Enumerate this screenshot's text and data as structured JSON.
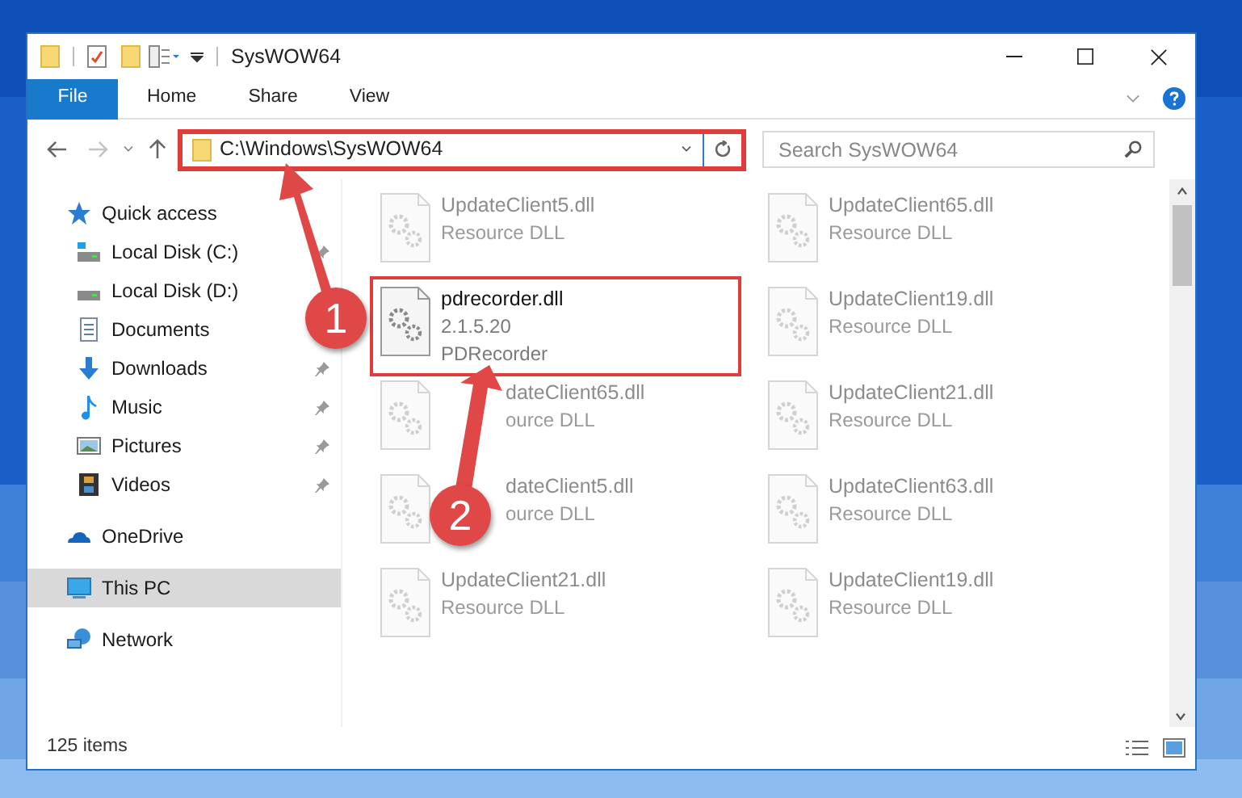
{
  "window": {
    "title": "SysWOW64"
  },
  "ribbon": {
    "tabs": [
      {
        "label": "File",
        "selected": true
      },
      {
        "label": "Home",
        "selected": false
      },
      {
        "label": "Share",
        "selected": false
      },
      {
        "label": "View",
        "selected": false
      }
    ]
  },
  "address": {
    "path": "C:\\Windows\\SysWOW64",
    "annotated": true
  },
  "search": {
    "placeholder": "Search SysWOW64"
  },
  "sidebar": {
    "items": [
      {
        "label": "Quick access",
        "kind": "quick",
        "selected": false,
        "pinned": false,
        "children": [
          {
            "label": "Local Disk (C:)",
            "kind": "diskc",
            "selected": false,
            "pinned": true
          },
          {
            "label": "Local Disk (D:)",
            "kind": "disk",
            "selected": false,
            "pinned": false
          },
          {
            "label": "Documents",
            "kind": "documents",
            "selected": false,
            "pinned": false
          },
          {
            "label": "Downloads",
            "kind": "downloads",
            "selected": false,
            "pinned": true
          },
          {
            "label": "Music",
            "kind": "music",
            "selected": false,
            "pinned": true
          },
          {
            "label": "Pictures",
            "kind": "pictures",
            "selected": false,
            "pinned": true
          },
          {
            "label": "Videos",
            "kind": "videos",
            "selected": false,
            "pinned": true
          }
        ]
      },
      {
        "label": "OneDrive",
        "kind": "onedrive",
        "selected": false,
        "pinned": false
      },
      {
        "label": "This PC",
        "kind": "pc",
        "selected": true,
        "pinned": false
      },
      {
        "label": "Network",
        "kind": "network",
        "selected": false,
        "pinned": false
      }
    ]
  },
  "files": [
    {
      "name": "UpdateClient5.dll",
      "details": [
        "Resource DLL"
      ],
      "blurred": true,
      "annotated": false
    },
    {
      "name": "UpdateClient65.dll",
      "details": [
        "Resource DLL"
      ],
      "blurred": true,
      "annotated": false
    },
    {
      "name": "pdrecorder.dll",
      "details": [
        "2.1.5.20",
        "PDRecorder"
      ],
      "blurred": false,
      "annotated": true
    },
    {
      "name": "UpdateClient19.dll",
      "details": [
        "Resource DLL"
      ],
      "blurred": true,
      "annotated": false
    },
    {
      "name": "dateClient65.dll",
      "details": [
        "ource DLL"
      ],
      "blurred": true,
      "annotated": false,
      "covered": true
    },
    {
      "name": "UpdateClient21.dll",
      "details": [
        "Resource DLL"
      ],
      "blurred": true,
      "annotated": false
    },
    {
      "name": "dateClient5.dll",
      "details": [
        "ource DLL"
      ],
      "blurred": true,
      "annotated": false,
      "covered": true
    },
    {
      "name": "UpdateClient63.dll",
      "details": [
        "Resource DLL"
      ],
      "blurred": true,
      "annotated": false
    },
    {
      "name": "UpdateClient21.dll",
      "details": [
        "Resource DLL"
      ],
      "blurred": true,
      "annotated": false
    },
    {
      "name": "UpdateClient19.dll",
      "details": [
        "Resource DLL"
      ],
      "blurred": true,
      "annotated": false
    }
  ],
  "status_bar": {
    "count": "125 items"
  },
  "callouts": [
    {
      "number": "1"
    },
    {
      "number": "2"
    }
  ]
}
